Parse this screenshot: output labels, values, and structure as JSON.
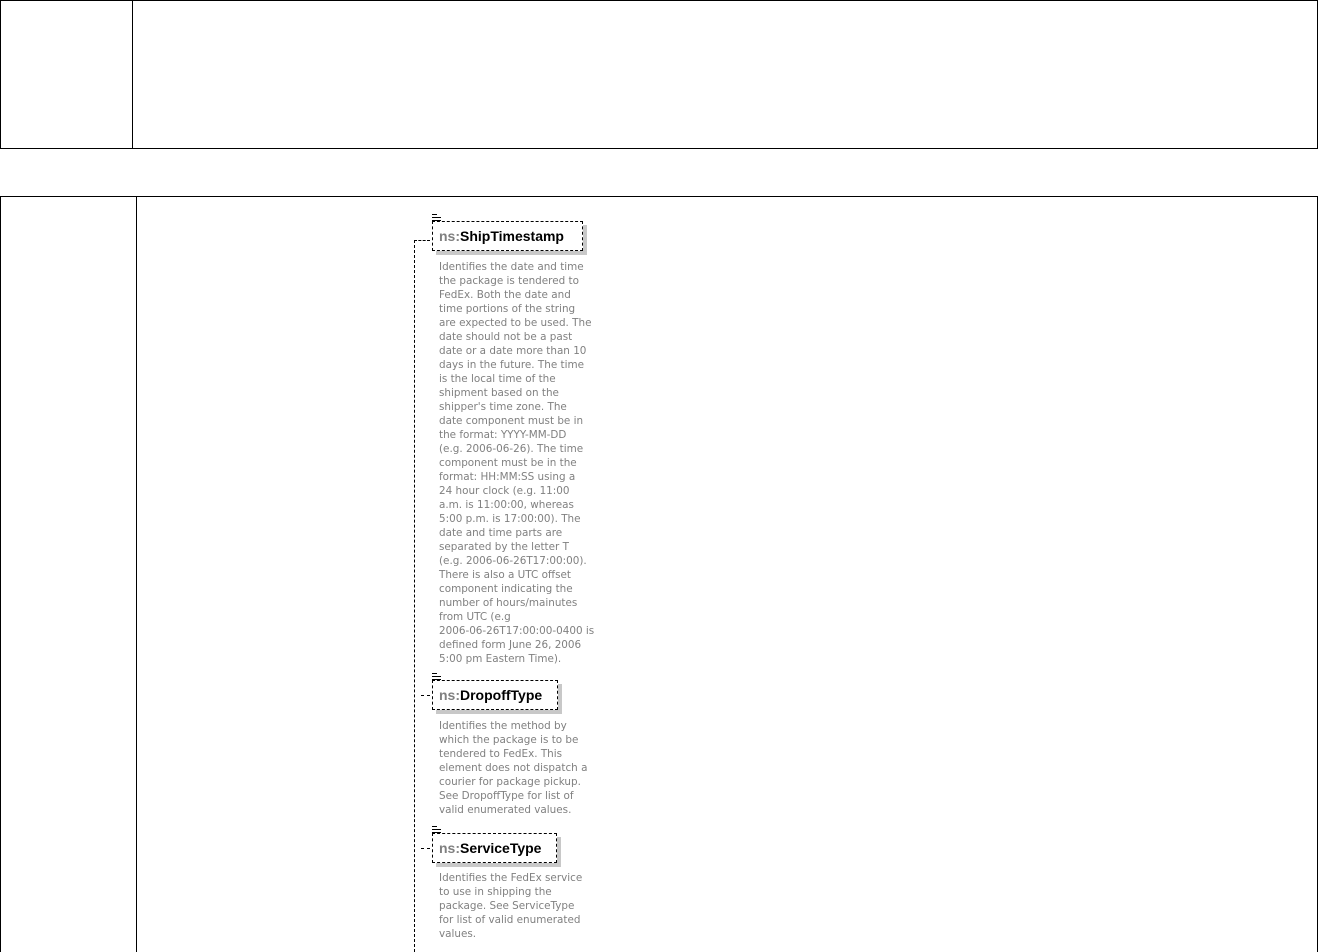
{
  "elements": [
    {
      "prefix": "ns:",
      "name": "ShipTimestamp",
      "doc_lines": [
        "Identifies the date and time",
        "the package is tendered to",
        "FedEx. Both the date and",
        "time portions of the string",
        "are expected to be used. The",
        "date should not be a past",
        "date or a date more than 10",
        "days in the future. The time",
        "is the local time of the",
        "shipment based on the",
        "shipper's time zone. The",
        "date component must be in",
        "the format: YYYY-MM-DD",
        "(e.g. 2006-06-26). The time",
        "component must be in the",
        "format: HH:MM:SS using a",
        "24 hour clock (e.g. 11:00",
        "a.m. is 11:00:00, whereas",
        "5:00 p.m. is 17:00:00). The",
        "date and time parts are",
        "separated by the letter T",
        "(e.g. 2006-06-26T17:00:00).",
        "There is also a UTC offset",
        "component indicating the",
        "number of hours/mainutes",
        "from UTC (e.g",
        "2006-06-26T17:00:00-0400 is",
        "defined form June 26, 2006",
        "5:00 pm Eastern Time)."
      ]
    },
    {
      "prefix": "ns:",
      "name": "DropoffType",
      "doc_lines": [
        "Identifies the method by",
        "which the package is to be",
        "tendered to FedEx. This",
        "element does not dispatch a",
        "courier for package pickup.",
        "See DropoffType for list of",
        "valid enumerated values."
      ]
    },
    {
      "prefix": "ns:",
      "name": "ServiceType",
      "doc_lines": [
        "Identifies the FedEx service",
        "to use in shipping the",
        "package. See ServiceType",
        "for list of valid enumerated",
        "values."
      ]
    }
  ]
}
